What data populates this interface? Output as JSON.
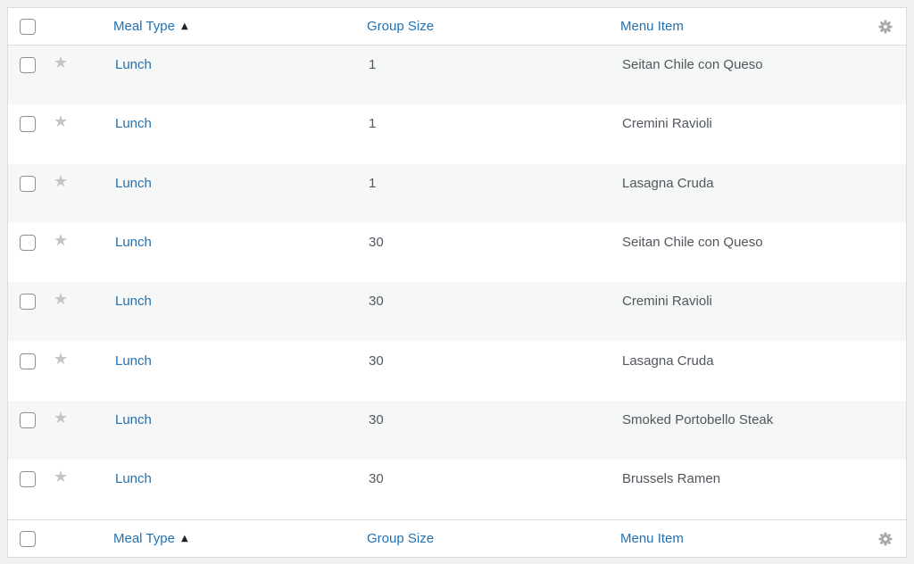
{
  "header": {
    "meal_type_label": "Meal Type",
    "group_size_label": "Group Size",
    "menu_item_label": "Menu Item",
    "sort_indicator": "▲"
  },
  "rows": [
    {
      "meal_type": "Lunch",
      "group_size": "1",
      "menu_item": "Seitan Chile con Queso"
    },
    {
      "meal_type": "Lunch",
      "group_size": "1",
      "menu_item": "Cremini Ravioli"
    },
    {
      "meal_type": "Lunch",
      "group_size": "1",
      "menu_item": "Lasagna Cruda"
    },
    {
      "meal_type": "Lunch",
      "group_size": "30",
      "menu_item": "Seitan Chile con Queso"
    },
    {
      "meal_type": "Lunch",
      "group_size": "30",
      "menu_item": "Cremini Ravioli"
    },
    {
      "meal_type": "Lunch",
      "group_size": "30",
      "menu_item": "Lasagna Cruda"
    },
    {
      "meal_type": "Lunch",
      "group_size": "30",
      "menu_item": "Smoked Portobello Steak"
    },
    {
      "meal_type": "Lunch",
      "group_size": "30",
      "menu_item": "Brussels Ramen"
    }
  ],
  "icons": {
    "star": "star-icon",
    "gear": "gear-icon",
    "sort": "sort-ascending-icon"
  },
  "colors": {
    "link": "#2271b1",
    "text": "#50575e",
    "alt_row": "#f6f7f7",
    "star": "#c3c4c7"
  }
}
